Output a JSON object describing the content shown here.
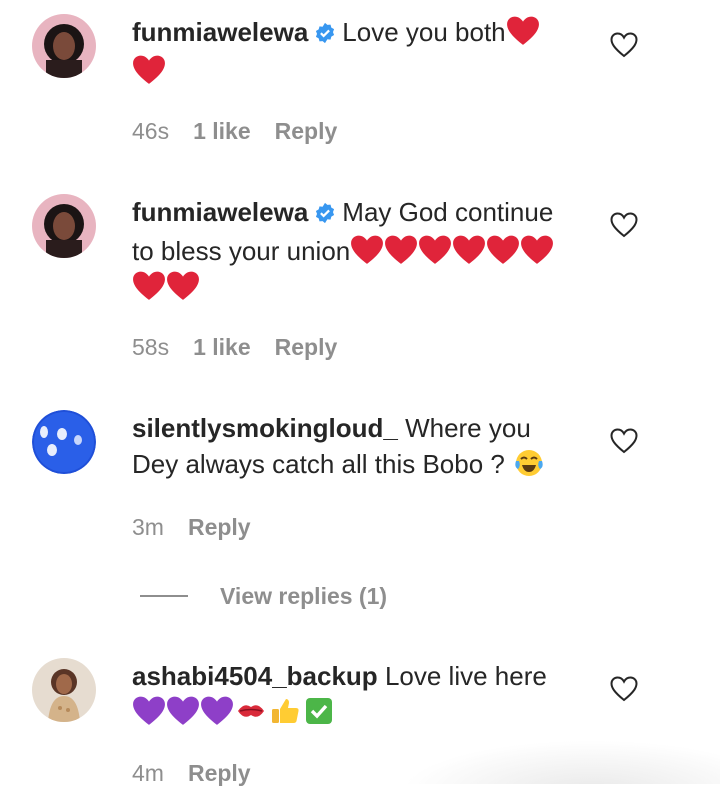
{
  "comments": [
    {
      "username": "funmiawelewa",
      "verified": true,
      "text": "Love you both",
      "emojis_inline": [
        "red-heart"
      ],
      "emojis_line2": [
        "red-heart"
      ],
      "time": "46s",
      "likes": "1 like",
      "reply": "Reply"
    },
    {
      "username": "funmiawelewa",
      "verified": true,
      "text": "May God continue",
      "text_line2": "to bless your union",
      "emojis_line2": [
        "red-heart",
        "red-heart",
        "red-heart",
        "red-heart",
        "red-heart",
        "red-heart"
      ],
      "emojis_line3": [
        "red-heart",
        "red-heart"
      ],
      "time": "58s",
      "likes": "1 like",
      "reply": "Reply"
    },
    {
      "username": "silentlysmokingloud_",
      "verified": false,
      "text": "Where you",
      "text_line2": "Dey always catch all this Bobo ?",
      "emojis_line2": [
        "tears-of-joy"
      ],
      "time": "3m",
      "reply": "Reply",
      "view_replies": "View replies (1)"
    },
    {
      "username": "ashabi4504_backup",
      "verified": false,
      "text": "Love live here",
      "emojis_line2": [
        "purple-heart",
        "purple-heart",
        "purple-heart",
        "kiss-mark",
        "thumbs-up",
        "check-mark-button"
      ],
      "time": "4m",
      "reply": "Reply"
    }
  ],
  "colors": {
    "text": "#262626",
    "meta": "#8e8e8e",
    "verified": "#3897f0",
    "red_heart": "#e0243a",
    "purple_heart": "#8e3fc8"
  },
  "icons": [
    "heart-outline-icon",
    "verified-badge-icon"
  ]
}
